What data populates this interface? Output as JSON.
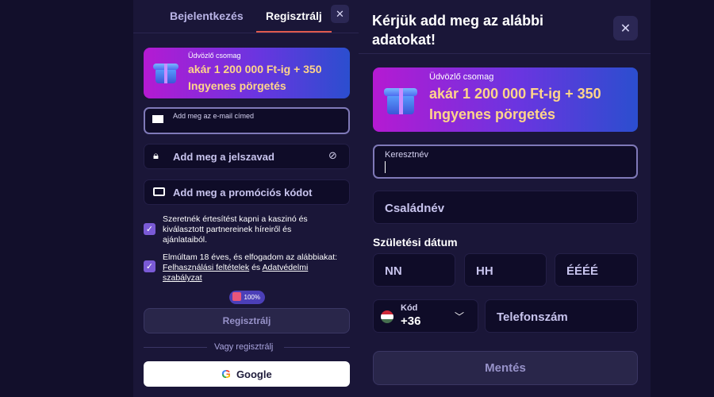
{
  "left": {
    "tabs": {
      "login": "Bejelentkezés",
      "register": "Regisztrálj"
    },
    "close_icon": "✕",
    "banner": {
      "label": "Üdvözlő csomag",
      "title_line1": "akár 1 200 000 Ft-ig + 350",
      "title_line2": "Ingyenes pörgetés"
    },
    "email": {
      "label": "Add meg az e-mail címed",
      "icon": "envelope-icon"
    },
    "password": {
      "placeholder": "Add meg a jelszavad",
      "icon": "lock-icon",
      "toggle_icon": "eye-off-icon"
    },
    "promo": {
      "placeholder": "Add meg a promóciós kódot",
      "icon": "ticket-icon"
    },
    "consent1": {
      "text": "Szeretnék értesítést kapni a kaszinó és kiválasztott partnereinek híreiről és ajánlataiból.",
      "checked": true
    },
    "consent2": {
      "prefix": "Elmúltam 18 éves, és elfogadom az alábbiakat: ",
      "link1": "Felhasználási feltételek",
      "mid": " és ",
      "link2": "Adatvédelmi szabályzat",
      "checked": true
    },
    "progress": "100%",
    "register_button": "Regisztrálj",
    "divider": "Vagy regisztrálj",
    "google_button": "Google"
  },
  "right": {
    "title": "Kérjük add meg az alábbi adatokat!",
    "close_icon": "✕",
    "banner": {
      "label": "Üdvözlő csomag",
      "title_line1": "akár 1 200 000 Ft-ig + 350",
      "title_line2": "Ingyenes pörgetés"
    },
    "first_name": {
      "label": "Keresztnév",
      "value": ""
    },
    "last_name": {
      "placeholder": "Családnév"
    },
    "dob": {
      "label": "Születési dátum",
      "day": "NN",
      "month": "HH",
      "year": "ÉÉÉÉ"
    },
    "country_code": {
      "label": "Kód",
      "value": "+36",
      "flag": "hungary-flag"
    },
    "phone": {
      "placeholder": "Telefonszám"
    },
    "save_button": "Mentés"
  },
  "colors": {
    "accent": "#7a5ad6",
    "background": "#1a1638",
    "banner_title": "#ffd58a"
  }
}
